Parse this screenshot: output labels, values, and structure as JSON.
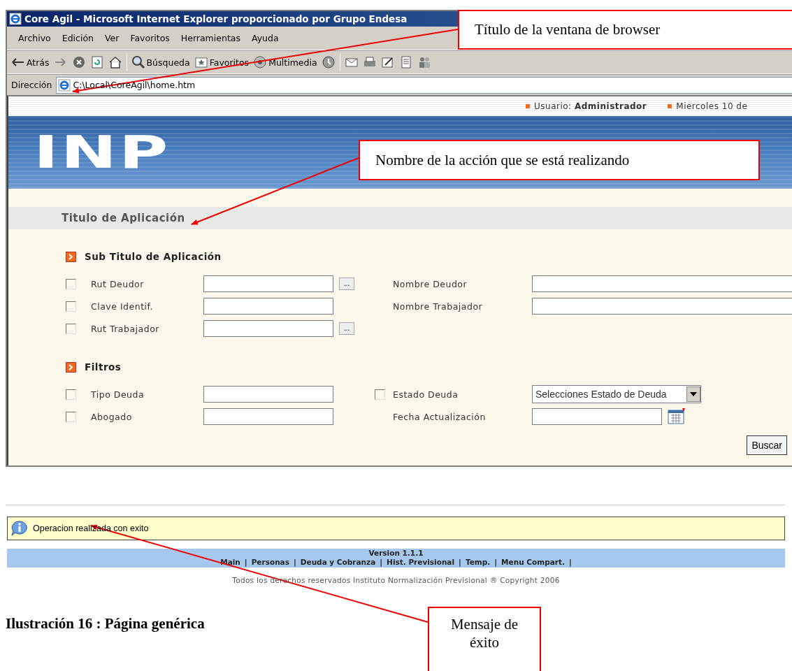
{
  "window": {
    "title": "Core Agil - Microsoft Internet Explorer proporcionado por Grupo Endesa",
    "menu": [
      "Archivo",
      "Edición",
      "Ver",
      "Favoritos",
      "Herramientas",
      "Ayuda"
    ],
    "toolbar": [
      {
        "kind": "back",
        "label": "Atrás"
      },
      {
        "kind": "forward"
      },
      {
        "kind": "stop"
      },
      {
        "kind": "refresh"
      },
      {
        "kind": "home"
      },
      {
        "kind": "sep"
      },
      {
        "kind": "search",
        "label": "Búsqueda"
      },
      {
        "kind": "favorites",
        "label": "Favoritos"
      },
      {
        "kind": "media",
        "label": "Multimedia"
      },
      {
        "kind": "history"
      },
      {
        "kind": "sep"
      },
      {
        "kind": "mail"
      },
      {
        "kind": "print"
      },
      {
        "kind": "edit"
      },
      {
        "kind": "doc"
      },
      {
        "kind": "people"
      }
    ],
    "address_label": "Dirección",
    "url": "C:\\Local\\CoreAgil\\home.htm"
  },
  "page": {
    "user_label": "Usuario:",
    "user": "Administrador",
    "date": "Miercoles 10 de",
    "logo": "INP",
    "app_title": "Titulo de Aplicación",
    "sections": [
      {
        "title": "Sub Titulo de Aplicación",
        "rows": [
          {
            "left": {
              "label": "Rut Deudor",
              "checked": false,
              "lookup": "..."
            },
            "right": {
              "kind": "text",
              "label": "Nombre Deudor"
            }
          },
          {
            "left": {
              "label": "Clave Identif.",
              "checked": false
            },
            "right": {
              "kind": "text",
              "label": "Nombre Trabajador"
            }
          },
          {
            "left": {
              "label": "Rut Trabajador",
              "checked": false,
              "lookup": "..."
            }
          }
        ]
      },
      {
        "title": "Filtros",
        "rows": [
          {
            "left": {
              "label": "Tipo Deuda",
              "checked": false
            },
            "right": {
              "kind": "select",
              "label": "Estado Deuda",
              "checked": false,
              "value": "Selecciones Estado de Deuda"
            }
          },
          {
            "left": {
              "label": "Abogado",
              "checked": false
            },
            "right": {
              "kind": "date",
              "label": "Fecha Actualización"
            }
          }
        ]
      }
    ],
    "search_button": "Buscar"
  },
  "message": "Operacion realizada con exito",
  "footer": {
    "version": "Version 1.1.1",
    "separator": "|",
    "links": [
      "Main",
      "Personas",
      "Deuda y Cobranza",
      "Hist. Previsional",
      "Temp.",
      "Menu Compart."
    ],
    "copyright": "Todos los derechos reservados Instituto Normalización Previsional ® Copyright 2006"
  },
  "caption": "Ilustración 16 : Página genérica",
  "callouts": [
    "Título de la ventana de browser",
    "Nombre de la acción que se está realizando",
    "Mensaje de éxito"
  ]
}
